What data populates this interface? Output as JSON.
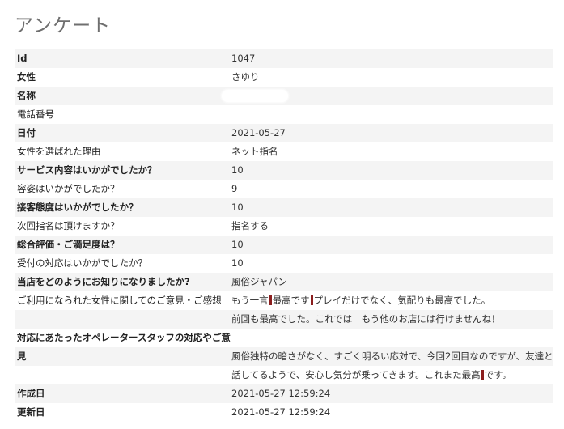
{
  "page": {
    "title": "アンケート"
  },
  "rows": {
    "id": {
      "label": "Id",
      "value": "1047"
    },
    "woman": {
      "label": "女性",
      "value": "さゆり"
    },
    "name": {
      "label": "名称",
      "value": ""
    },
    "phone": {
      "label": "電話番号",
      "value": ""
    },
    "date": {
      "label": "日付",
      "value": "2021-05-27"
    },
    "reason": {
      "label": "女性を選ばれた理由",
      "value": "ネット指名"
    },
    "service": {
      "label": "サービス内容はいかがでしたか？",
      "value": "10"
    },
    "appearance": {
      "label": "容姿はいかがでしたか？",
      "value": "9"
    },
    "attitude": {
      "label": "接客態度はいかがでしたか？",
      "value": "10"
    },
    "next": {
      "label": "次回指名は頂けますか？",
      "value": "指名する"
    },
    "overall": {
      "label": "総合評価・ご満足度は？",
      "value": "10"
    },
    "reception": {
      "label": "受付の対応はいかがでしたか？",
      "value": "10"
    },
    "source": {
      "label": "当店をどのようにお知りになりましたか?",
      "value": "風俗ジャパン"
    },
    "opinion": {
      "label": "ご利用になられた女性に関してのご意見・ご感想",
      "line1_part1": "もう一言",
      "line1_part2": "最高です",
      "line1_part3": "プレイだけでなく、気配りも最高でした。",
      "line2": "前回も最高でした。これでは　もう他のお店には行けませんね！"
    },
    "operator": {
      "label_line1": "対応にあたったオペレータースタッフの対応やご意",
      "label_line2": "見",
      "line1": "風俗独特の暗さがなく、すごく明るい応対で、今回2回目なのですが、友達と",
      "line2_part1": "話してるようで、安心し気分が乗ってきます。これまた最高",
      "line2_part2": "です。"
    },
    "created": {
      "label": "作成日",
      "value": "2021-05-27 12:59:24"
    },
    "updated": {
      "label": "更新日",
      "value": "2021-05-27 12:59:24"
    }
  }
}
